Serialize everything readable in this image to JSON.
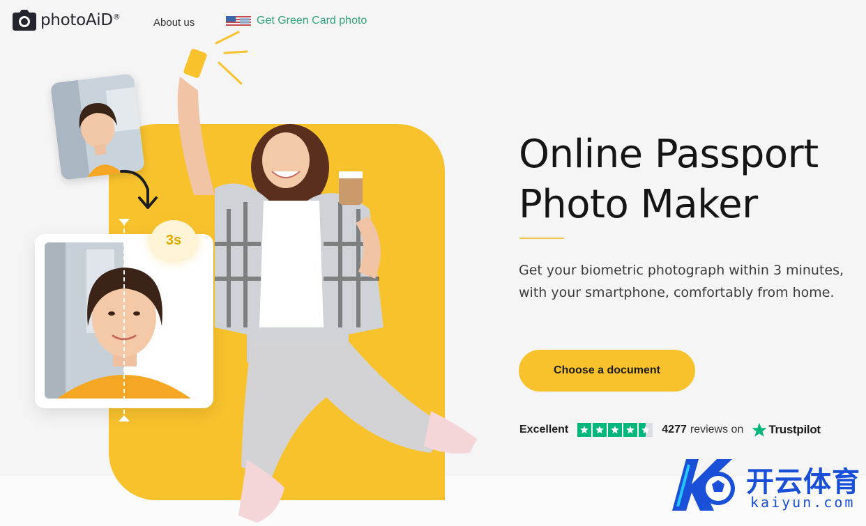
{
  "header": {
    "brand": "photoAiD",
    "brand_mark": "®",
    "logo_icon": "camera-icon",
    "nav": [
      {
        "label": "About us"
      },
      {
        "label": "Get Green Card photo",
        "icon": "us-flag-icon",
        "color": "#2fa37a"
      }
    ]
  },
  "hero": {
    "title_line1": "Online Passport",
    "title_line2": "Photo Maker",
    "subtitle": "Get your biometric photograph within 3 minutes, with your smartphone, comfortably from home.",
    "cta_label": "Choose a document",
    "timer_badge": "3s",
    "accent_color": "#f8c22d"
  },
  "reviews": {
    "rating_word": "Excellent",
    "stars": 4.5,
    "count": "4277",
    "text": "reviews on",
    "platform": "Trustpilot",
    "platform_color": "#00b67a"
  },
  "watermark": {
    "chinese": "开云体育",
    "latin": "kaiyun.com"
  }
}
